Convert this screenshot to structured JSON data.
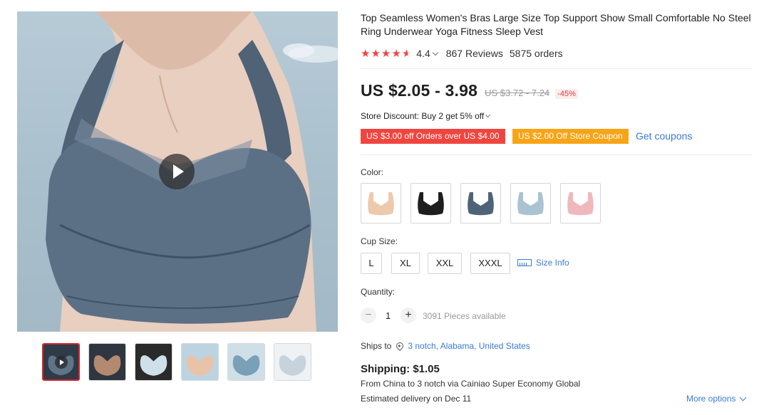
{
  "gallery": {
    "main_image": "product-photo-grey-bra",
    "play_icon": "play-icon",
    "thumbnails": [
      {
        "name": "thumbnail-1",
        "icon": "thumbnail-video",
        "colors": [
          "#5f7488",
          "#2f3b48"
        ]
      },
      {
        "name": "thumbnail-2",
        "icon": "thumbnail-back-view",
        "colors": [
          "#b38a70",
          "#2f3640"
        ]
      },
      {
        "name": "thumbnail-3",
        "icon": "thumbnail-flatlay",
        "colors": [
          "#cfe0ea",
          "#2a2a2a"
        ]
      },
      {
        "name": "thumbnail-4",
        "icon": "thumbnail-model",
        "colors": [
          "#e8c3a8",
          "#bcd4e2"
        ]
      },
      {
        "name": "thumbnail-5",
        "icon": "thumbnail-detail",
        "colors": [
          "#7aa0b8",
          "#cfdfe8"
        ]
      },
      {
        "name": "thumbnail-6",
        "icon": "thumbnail-fabric",
        "colors": [
          "#c7d3dc",
          "#eef2f5"
        ]
      }
    ]
  },
  "product": {
    "title": "Top Seamless Women's Bras Large Size Top Support Show Small Comfortable No Steel Ring Underwear Yoga Fitness Sleep Vest",
    "rating": "4.4",
    "reviews": "867 Reviews",
    "orders": "5875 orders"
  },
  "price": {
    "current": "US $2.05 - 3.98",
    "original": "US $3.72 - 7.24",
    "discount": "-45%"
  },
  "promotions": {
    "store_discount": "Store Discount: Buy 2 get 5% off",
    "coupon_1": "US $3.00 off Orders over US $4.00",
    "coupon_2": "US $2.00 Off Store Coupon",
    "get_coupons": "Get coupons"
  },
  "colors": {
    "label": "Color:",
    "options": [
      {
        "name": "nude",
        "fill": "#edc9ad"
      },
      {
        "name": "black",
        "fill": "#1e1e1e"
      },
      {
        "name": "grey-blue",
        "fill": "#4f6378"
      },
      {
        "name": "light-blue",
        "fill": "#a9c3d2"
      },
      {
        "name": "pink",
        "fill": "#efb8bd"
      }
    ]
  },
  "cup_size": {
    "label": "Cup Size:",
    "options": [
      "L",
      "XL",
      "XXL",
      "XXXL"
    ],
    "size_info": "Size Info"
  },
  "quantity": {
    "label": "Quantity:",
    "minus": "−",
    "value": "1",
    "plus": "+",
    "available": "3091 Pieces available"
  },
  "shipping": {
    "ships_to_label": "Ships to",
    "destination": "3 notch, Alabama, United States",
    "cost": "Shipping: $1.05",
    "route": "From China to 3 notch via Cainiao Super Economy Global",
    "delivery": "Estimated delivery on Dec 11",
    "more_options": "More options"
  },
  "accent_colors": {
    "price": "#1f1f1f",
    "discount": "#e4393c",
    "coupon_red": "#f0453f",
    "coupon_orange": "#f7a416",
    "link": "#3a7bd5",
    "star": "#ef4444"
  }
}
